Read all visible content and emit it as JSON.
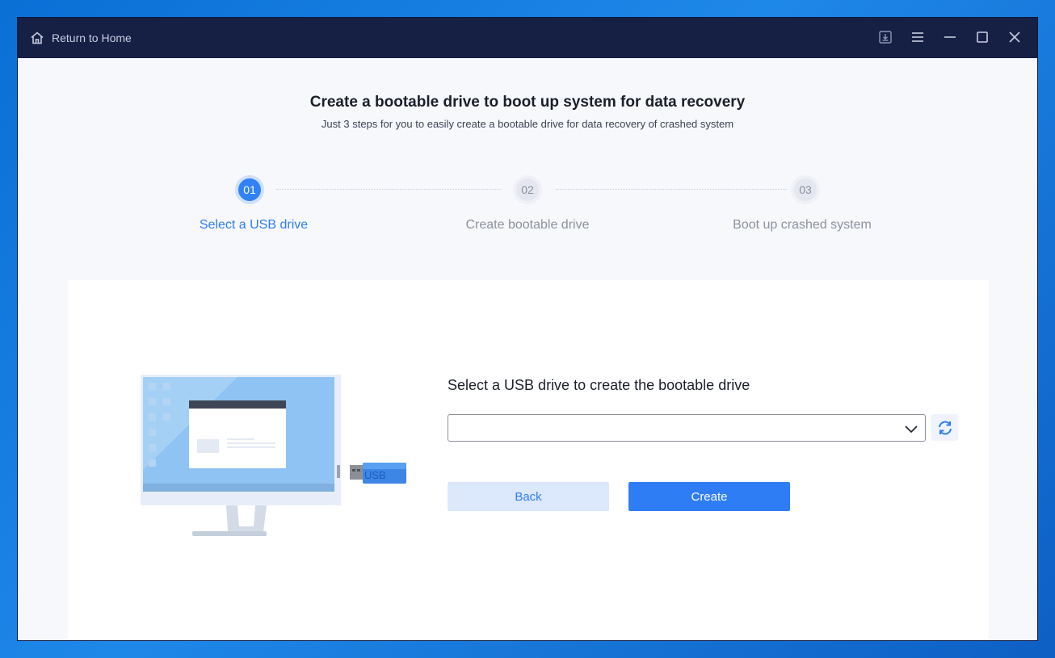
{
  "titlebar": {
    "home_label": "Return to Home",
    "icons": [
      "home-icon",
      "download-icon",
      "menu-icon",
      "minimize-icon",
      "maximize-icon",
      "close-icon"
    ]
  },
  "header": {
    "title": "Create a bootable drive to boot up system for data recovery",
    "subtitle": "Just 3 steps for you to easily create a bootable drive for data recovery of crashed system"
  },
  "steps": [
    {
      "number": "01",
      "label": "Select a USB drive",
      "state": "active"
    },
    {
      "number": "02",
      "label": "Create bootable drive",
      "state": "inactive"
    },
    {
      "number": "03",
      "label": "Boot up crashed system",
      "state": "inactive"
    }
  ],
  "form": {
    "title": "Select a USB drive to create the bootable drive",
    "selected_drive": "",
    "back_label": "Back",
    "create_label": "Create"
  },
  "illustration": {
    "usb_text": "USB"
  },
  "colors": {
    "accent": "#2e7df4",
    "titlebar": "#162044",
    "desktop": "#0a6fd6"
  }
}
